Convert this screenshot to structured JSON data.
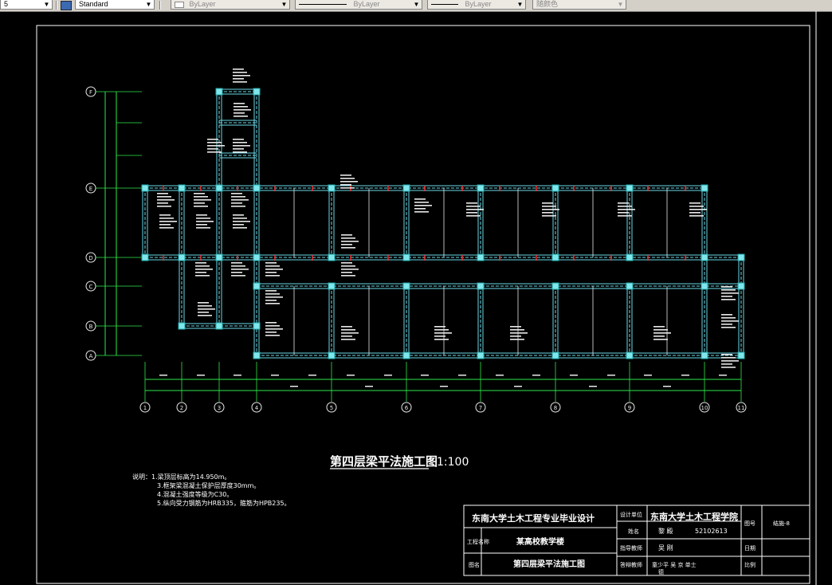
{
  "toolbar": {
    "left_value": "5",
    "text_style": "Standard",
    "layer": "ByLayer",
    "linetype": "ByLayer",
    "lineweight": "ByLayer",
    "plot_style": "随颜色"
  },
  "drawing": {
    "grid_rows": [
      "F",
      "E",
      "D",
      "C",
      "B",
      "A"
    ],
    "grid_cols": [
      "1",
      "2",
      "3",
      "4",
      "5",
      "6",
      "7",
      "8",
      "9",
      "10",
      "11"
    ],
    "title": "第四层梁平法施工图",
    "scale": "1:100",
    "notes_label": "说明：",
    "notes": [
      "1.梁顶层标高为14.950m。",
      "3.框架梁混凝土保护层厚度30mm。",
      "4.混凝土强度等级为C30。",
      "5.纵向受力钢筋为HRB335，箍筋为HPB235。"
    ]
  },
  "title_block": {
    "university_project": "东南大学土木工程专业毕业设计",
    "school_label": "设计单位",
    "school": "东南大学土木工程学院",
    "project_label": "工程名称",
    "project": "某高校教学楼",
    "name_label": "姓名",
    "name": "黎  殿",
    "student_id": "52102613",
    "advisor_label": "指导教师",
    "advisor": "吴  刚",
    "drawing_label": "图名",
    "drawing_name": "第四层梁平法施工图",
    "reviewer_label": "答辩教师",
    "reviewers": "童少平    吴  京    单士",
    "reviewers_extra": "德",
    "sheet_label": "图号",
    "sheet_no": "结施-8",
    "date_label": "日期",
    "scale_label": "比例"
  }
}
